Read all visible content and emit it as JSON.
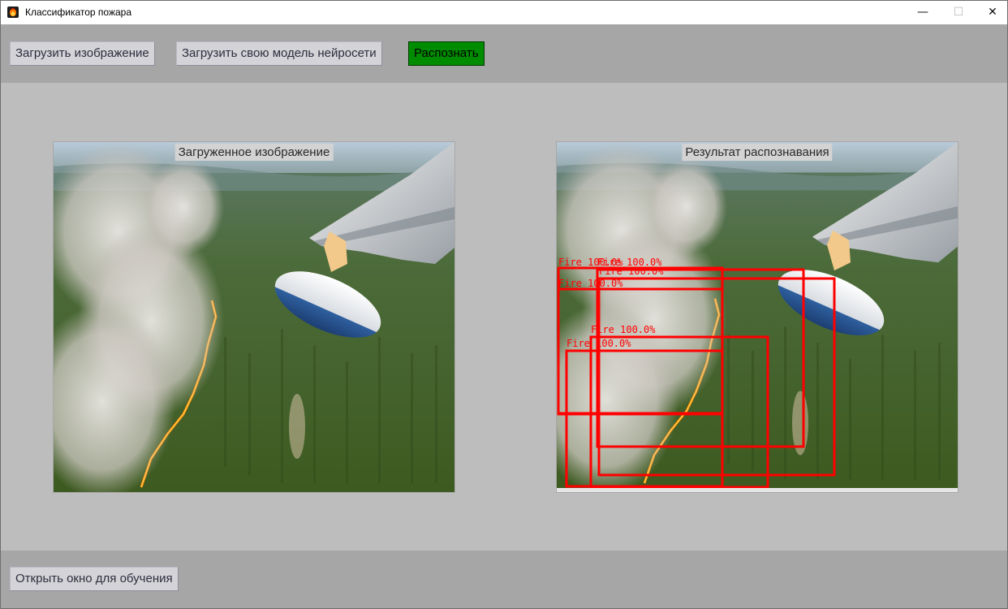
{
  "window": {
    "title": "Классификатор пожара",
    "controls": {
      "minimize": "—",
      "maximize": "☐",
      "close": "✕"
    }
  },
  "toolbar": {
    "load_image_label": "Загрузить изображение",
    "load_model_label": "Загрузить свою модель нейросети",
    "recognize_label": "Распознать"
  },
  "panels": {
    "loaded_title": "Загруженное изображение",
    "result_title": "Результат распознавания"
  },
  "detections": [
    {
      "label": "Fire 100.0%"
    },
    {
      "label": "Fire 100.0%"
    },
    {
      "label": "Fire 100.0%"
    },
    {
      "label": "Fire 100.0%"
    },
    {
      "label": "Fire 100.0%"
    },
    {
      "label": "Fire 100.0%"
    }
  ],
  "footer": {
    "open_training_label": "Открыть окно для обучения"
  },
  "colors": {
    "recognize_button": "#008c00",
    "detection_box": "#ff0000"
  }
}
